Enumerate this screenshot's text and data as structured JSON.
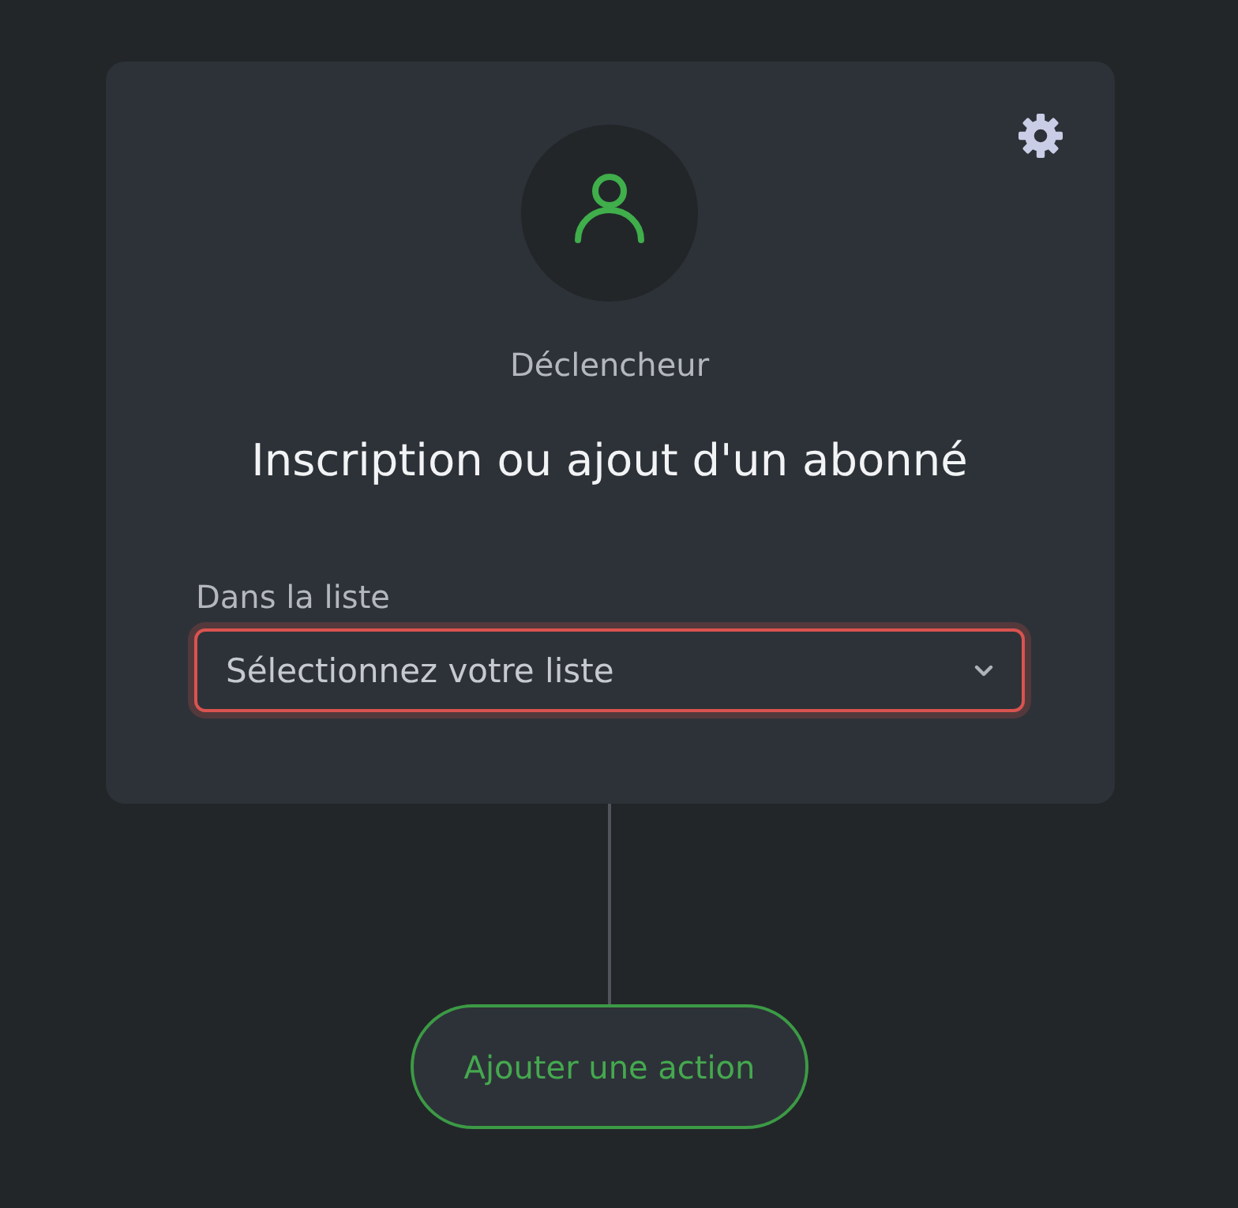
{
  "trigger": {
    "caption": "Déclencheur",
    "title": "Inscription ou ajout d'un abonné",
    "field": {
      "label": "Dans la liste",
      "placeholder": "Sélectionnez votre liste",
      "invalid": true
    }
  },
  "add_action_button": {
    "label": "Ajouter une action"
  }
}
